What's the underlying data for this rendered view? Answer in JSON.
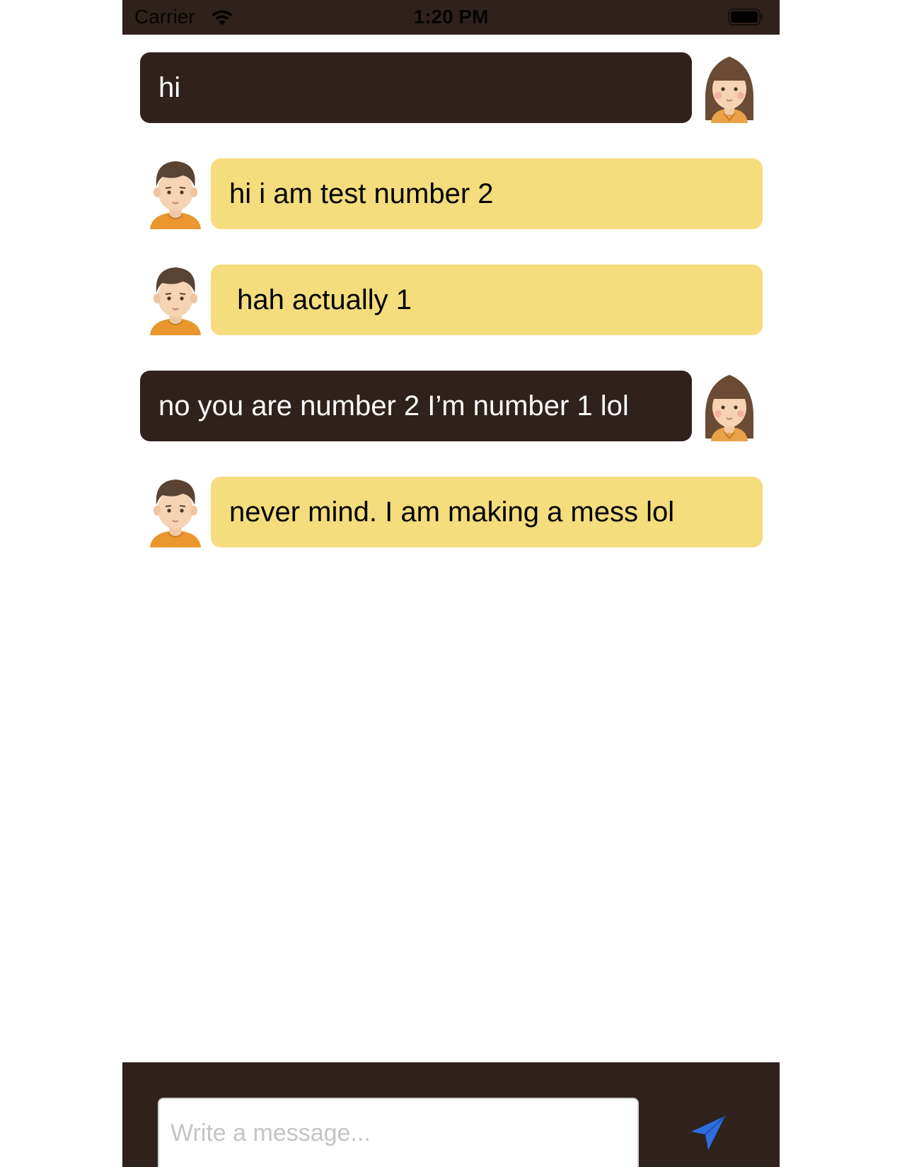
{
  "status_bar": {
    "carrier": "Carrier",
    "time": "1:20 PM",
    "wifi_icon": "wifi-icon",
    "battery_icon": "battery-icon"
  },
  "messages": [
    {
      "sender": "girl",
      "text": "hi",
      "avatar_icon": "girl-avatar-icon"
    },
    {
      "sender": "boy",
      "text": "hi i am test number 2",
      "avatar_icon": "boy-avatar-icon"
    },
    {
      "sender": "boy",
      "text": " hah actually 1",
      "avatar_icon": "boy-avatar-icon"
    },
    {
      "sender": "girl",
      "text": "no you are number 2 I’m number 1 lol",
      "avatar_icon": "girl-avatar-icon"
    },
    {
      "sender": "boy",
      "text": "never mind. I am making a mess lol",
      "avatar_icon": "boy-avatar-icon"
    }
  ],
  "composer": {
    "placeholder": "Write a message...",
    "value": "",
    "send_icon": "paper-plane-icon"
  },
  "colors": {
    "bar_background": "#2f221c",
    "dark_bubble": "#2f221c",
    "light_bubble": "#f5dc7c",
    "send_icon": "#2f6de0"
  }
}
